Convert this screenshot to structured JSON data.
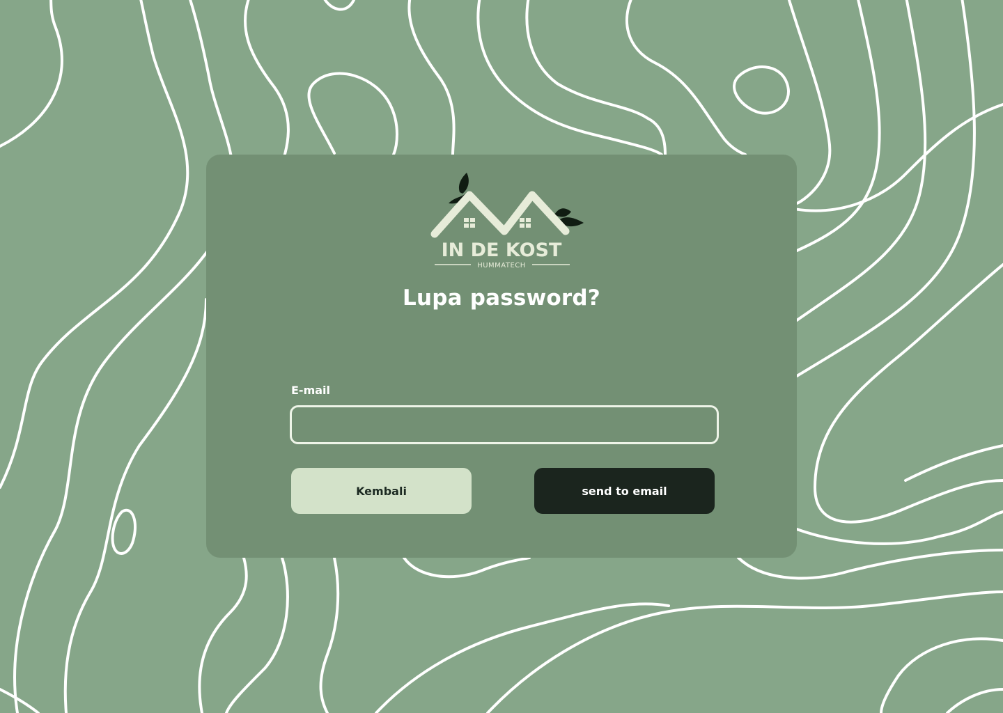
{
  "logo": {
    "name": "IN DE KOST",
    "tagline": "HUMMATECH"
  },
  "form": {
    "title": "Lupa password?",
    "email_label": "E-mail",
    "email_value": "",
    "email_placeholder": ""
  },
  "actions": {
    "back_label": "Kembali",
    "send_label": "send to email"
  },
  "colors": {
    "background": "#86a689",
    "card": "#739074",
    "back_button": "#d3e2c9",
    "send_button": "#1b251e",
    "logo_cream": "#e7ecd9",
    "leaf": "#101c12"
  }
}
